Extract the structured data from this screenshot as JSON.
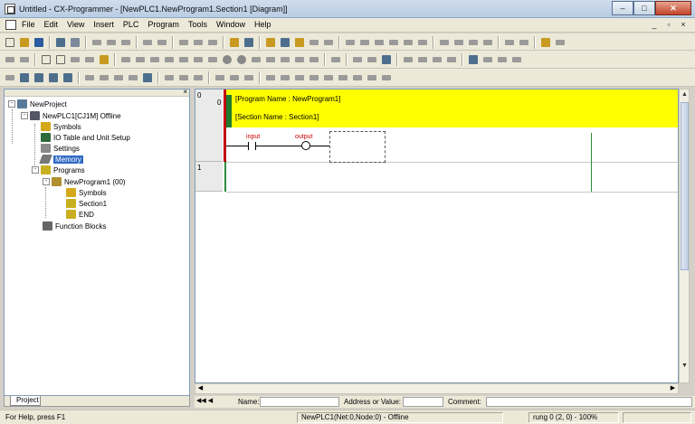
{
  "window": {
    "title": "Untitled - CX-Programmer - [NewPLC1.NewProgram1.Section1 [Diagram]]",
    "minimize_label": "–",
    "maximize_label": "□",
    "close_label": "✕"
  },
  "menubar": {
    "items": [
      "File",
      "Edit",
      "View",
      "Insert",
      "PLC",
      "Program",
      "Tools",
      "Window",
      "Help"
    ],
    "mdi": [
      "_",
      "▫",
      "×"
    ]
  },
  "project_tree": {
    "close_label": "×",
    "items": [
      {
        "label": "NewProject",
        "icon": "project-icon"
      },
      {
        "label": "NewPLC1[CJ1M] Offline",
        "icon": "plc-icon"
      },
      {
        "label": "Symbols",
        "icon": "symbols-icon"
      },
      {
        "label": "IO Table and Unit Setup",
        "icon": "io-table-icon"
      },
      {
        "label": "Settings",
        "icon": "settings-icon"
      },
      {
        "label": "Memory",
        "icon": "memory-icon",
        "selected": true
      },
      {
        "label": "Programs",
        "icon": "programs-icon"
      },
      {
        "label": "NewProgram1 (00)",
        "icon": "program-icon"
      },
      {
        "label": "Symbols",
        "icon": "symbols-icon"
      },
      {
        "label": "Section1",
        "icon": "section-icon"
      },
      {
        "label": "END",
        "icon": "end-icon"
      },
      {
        "label": "Function Blocks",
        "icon": "function-blocks-icon"
      }
    ],
    "tab_label": "Project"
  },
  "diagram": {
    "rungs": [
      "0",
      "1"
    ],
    "program_name": "[Program Name : NewProgram1]",
    "section_name": "[Section Name : Section1]",
    "contact_label": "input",
    "coil_label": "output",
    "colors": {
      "highlight": "#ffff00",
      "rail": "#2e8b3e",
      "bar": "#c00000"
    }
  },
  "infobar": {
    "name_label": "Name:",
    "address_label": "Address or Value:",
    "comment_label": "Comment:"
  },
  "statusbar": {
    "help": "For Help, press F1",
    "connection": "NewPLC1(Net:0,Node:0) - Offline",
    "position": "rung 0 (2, 0)  - 100%"
  }
}
